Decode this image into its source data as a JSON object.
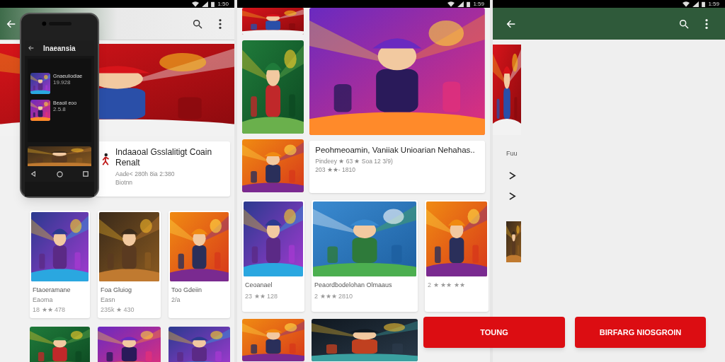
{
  "left_screen": {
    "status_time": "1:50",
    "featured": {
      "title": "Indaaoal Gsslalitigt Coain Renalt",
      "meta": "Aade< 280h 8ia 2:380",
      "publisher": "Biotnn"
    },
    "games": [
      {
        "title": "Ftaoeramane",
        "subtitle": "Eaoma",
        "rating": "18 ★★ 478"
      },
      {
        "title": "Foa Gluiog",
        "subtitle": "Easn",
        "rating": "235k ★ 430"
      },
      {
        "title": "Too Gdeiin",
        "subtitle": "2/a"
      }
    ]
  },
  "phone_mockup": {
    "title": "Inaeansia",
    "items": [
      {
        "title": "Gnaeuliodiae",
        "info": "19.928"
      },
      {
        "title": "Beaoil eoo",
        "info": "2.5.8"
      }
    ]
  },
  "middle_screen": {
    "status_time": "1:59",
    "featured": {
      "title": "Peohmeoamin, Vaniiak Unioarian Nehahas..",
      "meta": "Pindeey ★ 63 ★ Soa 12 3/9)",
      "rating": "203 ★★- 1810"
    },
    "games": [
      {
        "title": "Ceoanael",
        "rating": "23 ★★ 128"
      },
      {
        "title": "Peaordbodelohan Olmaaus",
        "rating": "2 ★★★ 2810"
      },
      {
        "rating": "2 ★ ★★ ★★"
      }
    ]
  },
  "right_screen": {
    "status_time": "1:59",
    "sliver_label": "Fuu"
  },
  "buttons": [
    "TOUNG",
    "BIRFARG NIOSGROIN"
  ]
}
